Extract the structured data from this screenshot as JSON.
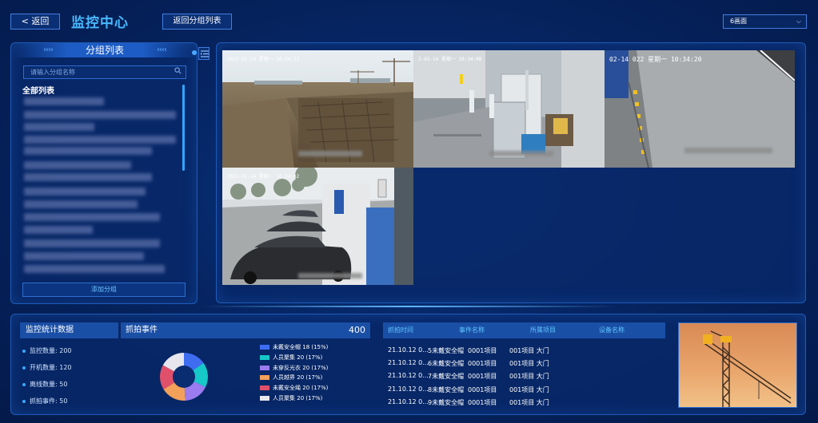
{
  "header": {
    "back_label": "< 返回",
    "title": "监控中心",
    "group_list_label": "返回分组列表",
    "layout_select_value": "6画面"
  },
  "sidebar": {
    "title": "分组列表",
    "search_placeholder": "请输入分组名称",
    "all_list_label": "全部列表",
    "add_group_label": "添加分组"
  },
  "cameras": [
    {
      "timestamp": "2022-02-14 星期一 10:34:12"
    },
    {
      "timestamp": "2-02-14 星期一 10:34:08"
    },
    {
      "timestamp": "02-14 022 星期一 10:34:20"
    },
    {
      "timestamp": "2022-02-14 星期一 10:34:02"
    }
  ],
  "stats": {
    "title": "监控统计数据",
    "items": [
      {
        "label": "监控数量:",
        "value": "200"
      },
      {
        "label": "开机数量:",
        "value": "120"
      },
      {
        "label": "离线数量:",
        "value": "50"
      },
      {
        "label": "抓拍事件:",
        "value": "50"
      }
    ]
  },
  "capture": {
    "title": "抓拍事件",
    "total": "400"
  },
  "chart_data": {
    "type": "pie",
    "title": "",
    "donut": true,
    "series": [
      {
        "name": "未戴安全帽",
        "value": 18,
        "label": "18 (15%)",
        "color": "#3e6df2"
      },
      {
        "name": "人员聚集",
        "value": 20,
        "label": "20 (17%)",
        "color": "#16c8c8"
      },
      {
        "name": "未穿反光衣",
        "value": 20,
        "label": "20 (17%)",
        "color": "#9b7bf0"
      },
      {
        "name": "人员越界",
        "value": 20,
        "label": "20 (17%)",
        "color": "#f2a05a"
      },
      {
        "name": "未戴安全绳",
        "value": 20,
        "label": "20 (17%)",
        "color": "#e0506a"
      },
      {
        "name": "人员聚集",
        "value": 20,
        "label": "20 (17%)",
        "color": "#e6e6ec"
      }
    ]
  },
  "events_table": {
    "headers": [
      "抓拍时间",
      "事件名称",
      "所属项目",
      "设备名称"
    ],
    "rows": [
      {
        "time": "21.10.12 0...",
        "event": "5未戴安全帽",
        "project": "0001项目",
        "device": "001项目 大门"
      },
      {
        "time": "21.10.12 0...",
        "event": "6未戴安全帽",
        "project": "0001项目",
        "device": "001项目 大门"
      },
      {
        "time": "21.10.12 0...",
        "event": "7未戴安全帽",
        "project": "0001项目",
        "device": "001项目 大门"
      },
      {
        "time": "21.10.12 0...",
        "event": "8未戴安全帽",
        "project": "0001项目",
        "device": "001项目 大门"
      },
      {
        "time": "21.10.12 0...",
        "event": "9未戴安全帽",
        "project": "0001项目",
        "device": "001项目 大门"
      }
    ]
  }
}
